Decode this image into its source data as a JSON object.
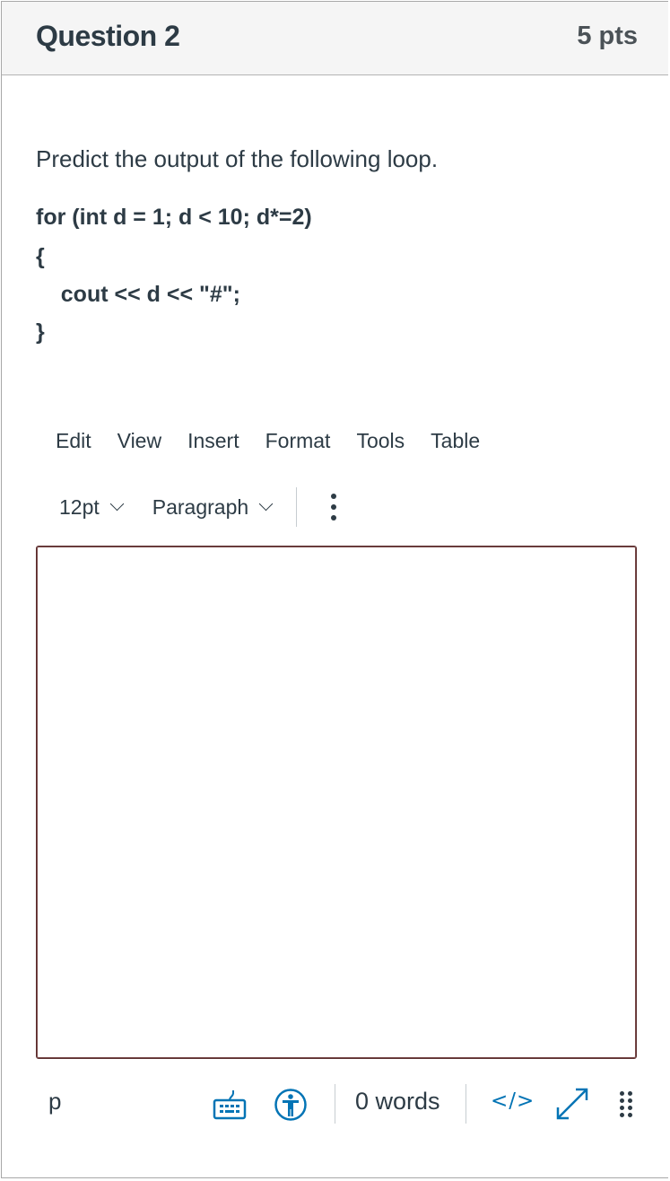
{
  "question": {
    "title": "Question 2",
    "points": "5 pts",
    "prompt": "Predict the output of the following loop.",
    "code_lines": [
      "for (int d = 1; d < 10; d*=2)",
      "{",
      "    cout << d << \"#\";",
      "}"
    ]
  },
  "editor": {
    "menubar": [
      "Edit",
      "View",
      "Insert",
      "Format",
      "Tools",
      "Table"
    ],
    "toolbar": {
      "font_size": "12pt",
      "block_format": "Paragraph",
      "more_icon": "kebab-vertical-icon"
    },
    "content": "",
    "statusbar": {
      "element_path": "p",
      "keyboard_icon": "keyboard-shortcuts-icon",
      "accessibility_icon": "accessibility-checker-icon",
      "word_count": "0 words",
      "html_editor_label": "</>",
      "fullscreen_icon": "expand-arrows-icon",
      "resize_icon": "drag-grip-icon"
    }
  },
  "colors": {
    "accent": "#0374b5",
    "text": "#2d3b45",
    "header_bg": "#f5f5f5",
    "editor_border": "#5a2d2d"
  }
}
